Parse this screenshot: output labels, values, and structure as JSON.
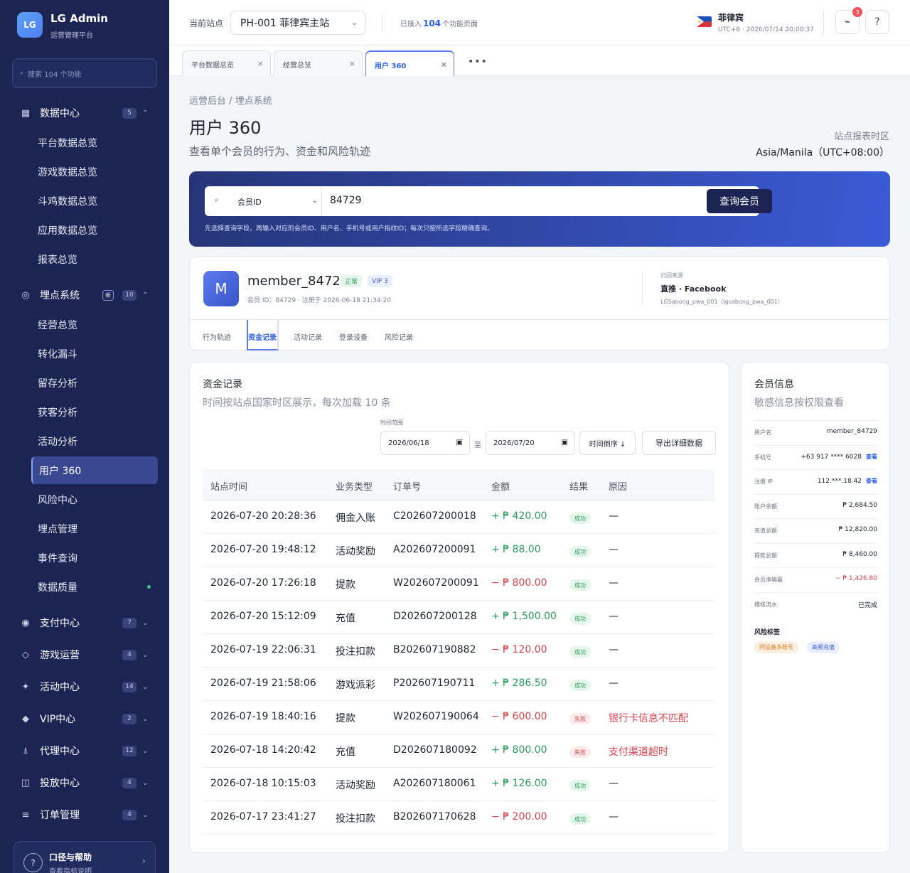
{
  "app": {
    "logo": "LG",
    "title": "LG Admin",
    "subtitle": "运营管理平台"
  },
  "sidebar": {
    "search_placeholder": "搜索 104 个功能",
    "groups": [
      {
        "label": "数据中心",
        "count": "5",
        "icon": "grid-icon",
        "expanded": true,
        "items": [
          {
            "label": "平台数据总览"
          },
          {
            "label": "游戏数据总览"
          },
          {
            "label": "斗鸡数据总览"
          },
          {
            "label": "应用数据总览"
          },
          {
            "label": "报表总览"
          }
        ]
      },
      {
        "label": "埋点系统",
        "count": "10",
        "new_badge": "新",
        "icon": "target-icon",
        "expanded": true,
        "items": [
          {
            "label": "经营总览"
          },
          {
            "label": "转化漏斗"
          },
          {
            "label": "留存分析"
          },
          {
            "label": "获客分析"
          },
          {
            "label": "活动分析"
          },
          {
            "label": "用户 360",
            "active": true
          },
          {
            "label": "风险中心"
          },
          {
            "label": "埋点管理"
          },
          {
            "label": "事件查询"
          },
          {
            "label": "数据质量",
            "status_dot": "#43c58a"
          }
        ]
      },
      {
        "label": "支付中心",
        "count": "7",
        "icon": "circle-icon"
      },
      {
        "label": "游戏运营",
        "count": "4",
        "icon": "diamond-outline-icon"
      },
      {
        "label": "活动中心",
        "count": "14",
        "icon": "sparkle-icon"
      },
      {
        "label": "VIP中心",
        "count": "2",
        "icon": "diamond-icon"
      },
      {
        "label": "代理中心",
        "count": "12",
        "icon": "agent-icon"
      },
      {
        "label": "投放中心",
        "count": "4",
        "icon": "panel-icon"
      },
      {
        "label": "订单管理",
        "count": "4",
        "icon": "list-icon"
      }
    ],
    "help": {
      "title": "口径与帮助",
      "subtitle": "查看指标说明"
    }
  },
  "topbar": {
    "site_label": "当前站点",
    "site_value": "PH-001 菲律宾主站",
    "connected_prefix": "已接入",
    "connected_count": "104",
    "connected_suffix": "个功能页面",
    "country": "菲律宾",
    "timezone": "UTC+8 · 2026/07/14 20:00:37",
    "notification_count": "3",
    "help_icon": "?"
  },
  "tabs": [
    {
      "label": "平台数据总览"
    },
    {
      "label": "经营总览"
    },
    {
      "label": "用户 360",
      "active": true
    }
  ],
  "page": {
    "breadcrumb": "运营后台 / 埋点系统",
    "title": "用户 360",
    "subtitle": "查看单个会员的行为、资金和风险轨迹",
    "tz_label": "站点报表时区",
    "tz_value": "Asia/Manila（UTC+08:00）"
  },
  "query": {
    "field": "会员ID",
    "value": "84729",
    "button": "查询会员",
    "hint": "先选择查询字段，再输入对应的会员ID、用户名、手机号或用户指纹ID；每次只按所选字段精确查询。"
  },
  "member": {
    "avatar": "M",
    "name": "member_84729",
    "status": "正常",
    "vip": "VIP 3",
    "meta": "会员 ID：84729 · 注册于 2026-06-18 21:34:20",
    "source_label": "归因来源",
    "source": "直推 · Facebook",
    "source_detail": "LGSabong_pwa_001（lgsabong_pwa_001）",
    "tabs": [
      {
        "label": "行为轨迹"
      },
      {
        "label": "资金记录",
        "active": true
      },
      {
        "label": "活动记录"
      },
      {
        "label": "登录设备"
      },
      {
        "label": "风险记录"
      }
    ]
  },
  "funds": {
    "title": "资金记录",
    "subtitle": "时间按站点国家时区展示，每次加载 10 条",
    "range_label": "时间范围",
    "date_from": "2026/06/18",
    "to": "至",
    "date_to": "2026/07/20",
    "sort_button": "时间倒序 ↓",
    "export_button": "导出详细数据",
    "columns": [
      "站点时间",
      "业务类型",
      "订单号",
      "金额",
      "结果",
      "原因"
    ],
    "rows": [
      {
        "time": "2026-07-20 20:28:36",
        "type": "佣金入账",
        "order": "C202607200018",
        "amount": "+ ₱ 420.00",
        "sign": "pos",
        "result": "成功",
        "ok": true,
        "reason": "—"
      },
      {
        "time": "2026-07-20 19:48:12",
        "type": "活动奖励",
        "order": "A202607200091",
        "amount": "+ ₱ 88.00",
        "sign": "pos",
        "result": "成功",
        "ok": true,
        "reason": "—"
      },
      {
        "time": "2026-07-20 17:26:18",
        "type": "提款",
        "order": "W202607200091",
        "amount": "− ₱ 800.00",
        "sign": "neg",
        "result": "成功",
        "ok": true,
        "reason": "—"
      },
      {
        "time": "2026-07-20 15:12:09",
        "type": "充值",
        "order": "D202607200128",
        "amount": "+ ₱ 1,500.00",
        "sign": "pos",
        "result": "成功",
        "ok": true,
        "reason": "—"
      },
      {
        "time": "2026-07-19 22:06:31",
        "type": "投注扣款",
        "order": "B202607190882",
        "amount": "− ₱ 120.00",
        "sign": "neg",
        "result": "成功",
        "ok": true,
        "reason": "—"
      },
      {
        "time": "2026-07-19 21:58:06",
        "type": "游戏派彩",
        "order": "P202607190711",
        "amount": "+ ₱ 286.50",
        "sign": "pos",
        "result": "成功",
        "ok": true,
        "reason": "—"
      },
      {
        "time": "2026-07-19 18:40:16",
        "type": "提款",
        "order": "W202607190064",
        "amount": "− ₱ 600.00",
        "sign": "neg",
        "result": "失败",
        "ok": false,
        "reason": "银行卡信息不匹配"
      },
      {
        "time": "2026-07-18 14:20:42",
        "type": "充值",
        "order": "D202607180092",
        "amount": "+ ₱ 800.00",
        "sign": "pos",
        "result": "失败",
        "ok": false,
        "reason": "支付渠道超时"
      },
      {
        "time": "2026-07-18 10:15:03",
        "type": "活动奖励",
        "order": "A202607180061",
        "amount": "+ ₱ 126.00",
        "sign": "pos",
        "result": "成功",
        "ok": true,
        "reason": "—"
      },
      {
        "time": "2026-07-17 23:41:27",
        "type": "投注扣款",
        "order": "B202607170628",
        "amount": "− ₱ 200.00",
        "sign": "neg",
        "result": "成功",
        "ok": true,
        "reason": "—"
      }
    ]
  },
  "info": {
    "title": "会员信息",
    "subtitle": "敏感信息按权限查看",
    "fields": [
      {
        "key": "用户名",
        "value": "member_84729"
      },
      {
        "key": "手机号",
        "value": "+63 917 **** 6028",
        "link": "查看"
      },
      {
        "key": "注册 IP",
        "value": "112.***.18.42",
        "link": "查看"
      },
      {
        "key": "账户余额",
        "value": "₱ 2,684.50"
      },
      {
        "key": "充值总额",
        "value": "₱ 12,820.00"
      },
      {
        "key": "提款总额",
        "value": "₱ 8,460.00"
      },
      {
        "key": "会员净输赢",
        "value": "− ₱ 1,426.80",
        "neg": true
      },
      {
        "key": "稽核流水",
        "value": "已完成"
      }
    ],
    "risk_label": "风险标签",
    "risk_tags": [
      "同设备多账号",
      "高频充值"
    ]
  }
}
